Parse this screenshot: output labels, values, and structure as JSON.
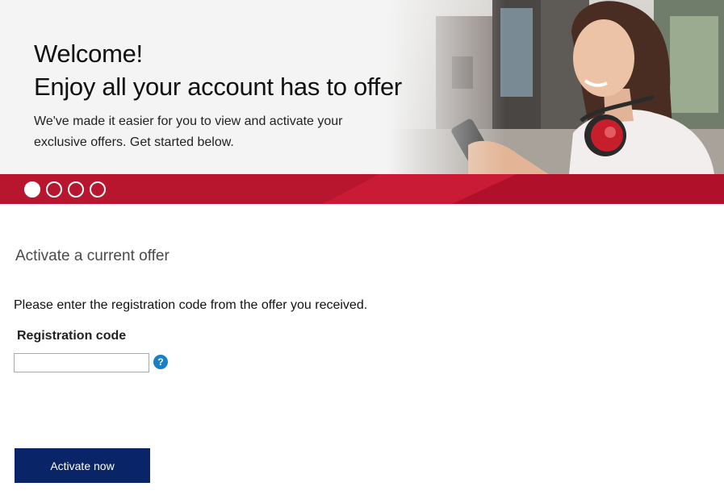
{
  "hero": {
    "headline_line1": "Welcome!",
    "headline_line2": "Enjoy all your account has to offer",
    "subtext": "We've made it easier for you to view and activate your exclusive offers. Get started below.",
    "photo_icon": "woman-with-phone-and-headphones-photo"
  },
  "carousel": {
    "slides_total": 4,
    "active_slide": 1,
    "bar_color": "#b8152f"
  },
  "offer_form": {
    "section_title": "Activate a current offer",
    "instructions": "Please enter the registration code from the offer you received.",
    "registration_label": "Registration code",
    "registration_value": "",
    "help_glyph": "?",
    "help_icon": "question-circle-icon",
    "submit_label": "Activate now",
    "submit_color": "#0a2468",
    "help_color": "#1a7fc4"
  }
}
